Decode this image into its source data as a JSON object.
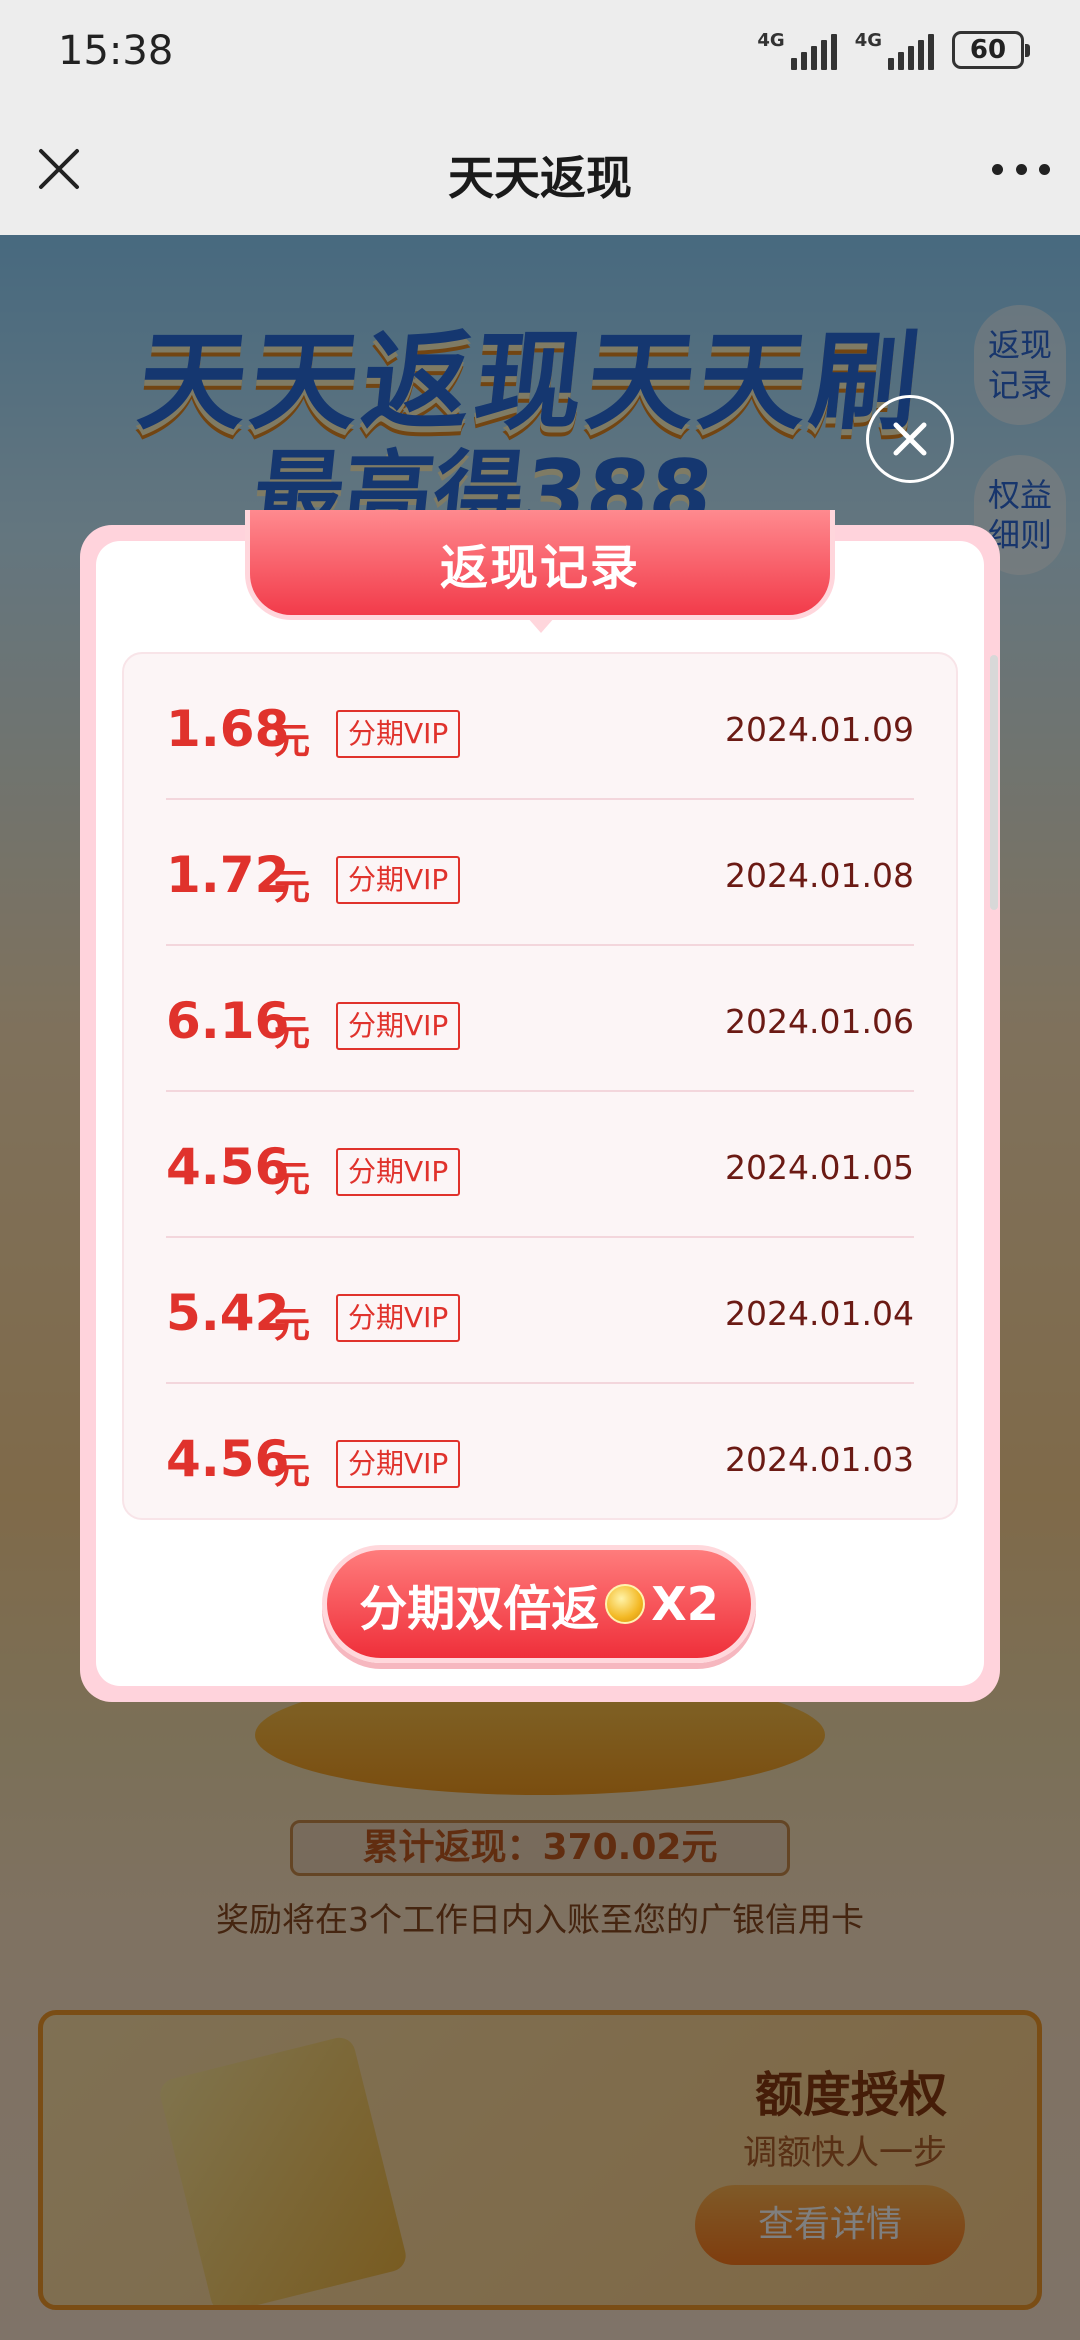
{
  "status_bar": {
    "time": "15:38",
    "network1": "4G",
    "network2": "4G",
    "battery": "60"
  },
  "nav": {
    "title": "天天返现"
  },
  "page": {
    "hero_line1": "天天返现天天刷",
    "hero_line2": "最高得388",
    "side_buttons": [
      "返现\n记录",
      "权益\n细则"
    ],
    "total": "累计返现：370.02元",
    "notice": "奖励将在3个工作日内入账至您的广银信用卡",
    "promo": {
      "title": "额度授权",
      "subtitle": "调额快人一步",
      "button": "查看详情"
    }
  },
  "modal": {
    "title": "返现记录",
    "records": [
      {
        "amount": "1.68",
        "unit": "元",
        "tag": "分期VIP",
        "date": "2024.01.09"
      },
      {
        "amount": "1.72",
        "unit": "元",
        "tag": "分期VIP",
        "date": "2024.01.08"
      },
      {
        "amount": "6.16",
        "unit": "元",
        "tag": "分期VIP",
        "date": "2024.01.06"
      },
      {
        "amount": "4.56",
        "unit": "元",
        "tag": "分期VIP",
        "date": "2024.01.05"
      },
      {
        "amount": "5.42",
        "unit": "元",
        "tag": "分期VIP",
        "date": "2024.01.04"
      },
      {
        "amount": "4.56",
        "unit": "元",
        "tag": "分期VIP",
        "date": "2024.01.03"
      }
    ],
    "cta_label": "分期双倍返",
    "cta_multiplier": "X2"
  },
  "colors": {
    "accent_red": "#e0322c",
    "ribbon": "#f23b4a",
    "modal_border": "#ffd3dc"
  },
  "icons": {
    "nav_close": "close-icon",
    "nav_more": "more-icon",
    "modal_close": "close-icon",
    "coin": "coin-icon"
  }
}
